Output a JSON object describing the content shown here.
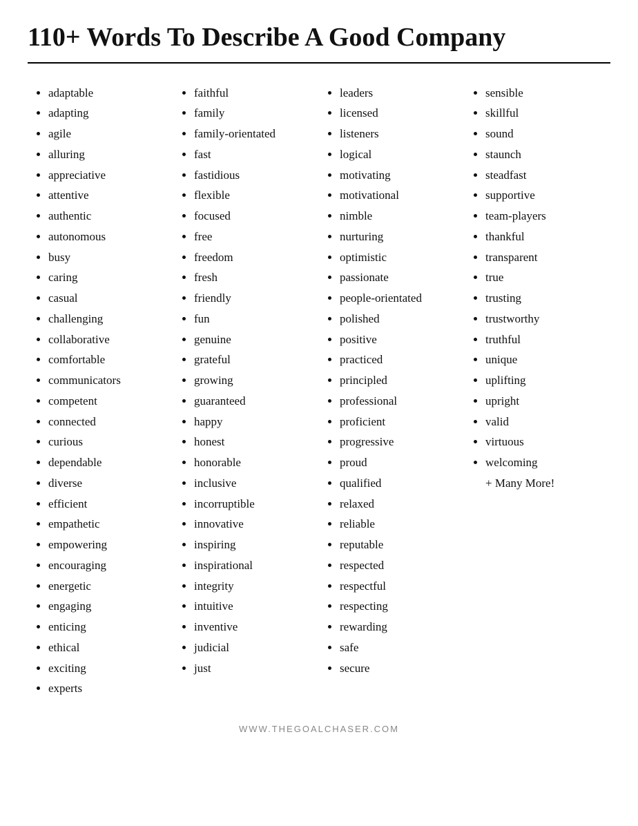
{
  "page": {
    "title": "110+ Words To Describe A Good Company",
    "footer": "WWW.THEGOALCHASER.COM"
  },
  "columns": [
    {
      "id": "col1",
      "items": [
        "adaptable",
        "adapting",
        "agile",
        "alluring",
        "appreciative",
        "attentive",
        "authentic",
        "autonomous",
        "busy",
        "caring",
        "casual",
        "challenging",
        "collaborative",
        "comfortable",
        "communicators",
        "competent",
        "connected",
        "curious",
        "dependable",
        "diverse",
        "efficient",
        "empathetic",
        "empowering",
        "encouraging",
        "energetic",
        "engaging",
        "enticing",
        "ethical",
        "exciting",
        "experts"
      ]
    },
    {
      "id": "col2",
      "items": [
        "faithful",
        "family",
        "family-orientated",
        "fast",
        "fastidious",
        "flexible",
        "focused",
        "free",
        "freedom",
        "fresh",
        "friendly",
        "fun",
        "genuine",
        "grateful",
        "growing",
        "guaranteed",
        "happy",
        "honest",
        "honorable",
        "inclusive",
        "incorruptible",
        "innovative",
        "inspiring",
        "inspirational",
        "integrity",
        "intuitive",
        "inventive",
        "judicial",
        "just"
      ]
    },
    {
      "id": "col3",
      "items": [
        "leaders",
        "licensed",
        "listeners",
        "logical",
        "motivating",
        "motivational",
        "nimble",
        "nurturing",
        "optimistic",
        "passionate",
        "people-orientated",
        "polished",
        "positive",
        "practiced",
        "principled",
        "professional",
        "proficient",
        "progressive",
        "proud",
        "qualified",
        "relaxed",
        "reliable",
        "reputable",
        "respected",
        "respectful",
        "respecting",
        "rewarding",
        "safe",
        "secure"
      ]
    },
    {
      "id": "col4",
      "items": [
        "sensible",
        "skillful",
        "sound",
        "staunch",
        "steadfast",
        "supportive",
        " team-players",
        "thankful",
        "transparent",
        "true",
        "trusting",
        "trustworthy",
        "truthful",
        "unique",
        "uplifting",
        "upright",
        "valid",
        "virtuous",
        "welcoming"
      ],
      "extra": "+ Many More!"
    }
  ]
}
